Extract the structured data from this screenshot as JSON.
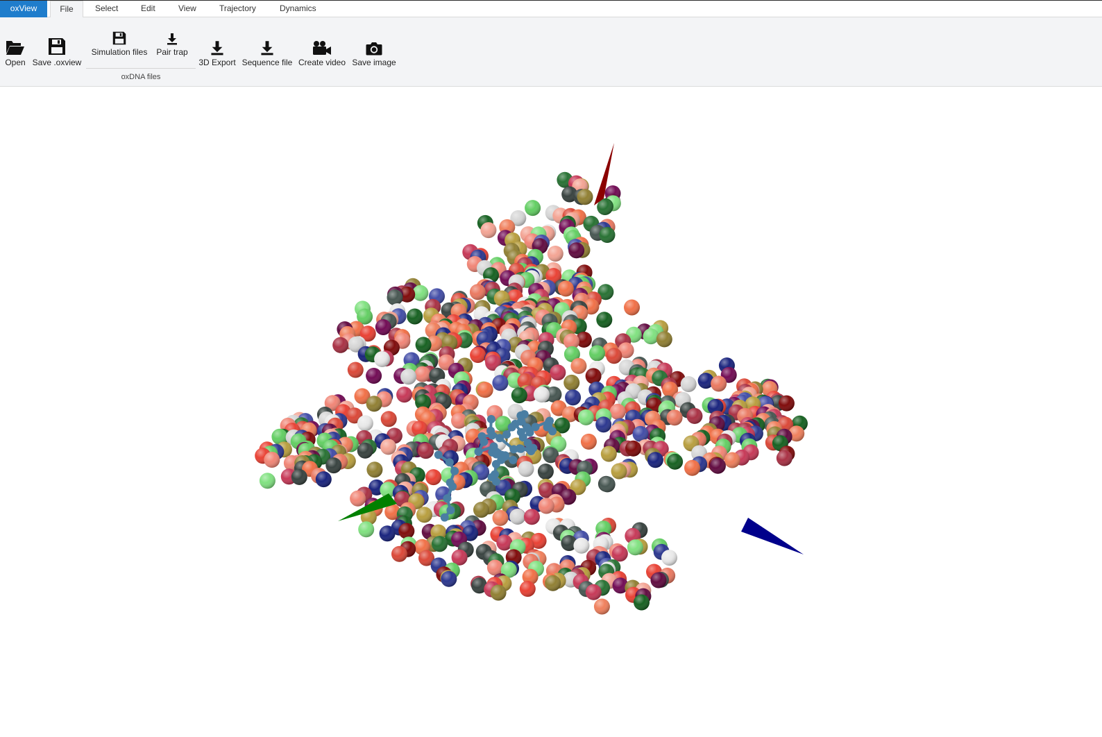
{
  "app": {
    "brand": "oxView"
  },
  "tabs": [
    {
      "label": "File",
      "active": true
    },
    {
      "label": "Select"
    },
    {
      "label": "Edit"
    },
    {
      "label": "View"
    },
    {
      "label": "Trajectory"
    },
    {
      "label": "Dynamics"
    }
  ],
  "ribbon": {
    "open": {
      "label": "Open",
      "icon": "folder-open-icon"
    },
    "save_oxview": {
      "label": "Save .oxview",
      "icon": "floppy-disk-icon"
    },
    "simulation_files": {
      "label": "Simulation files",
      "icon": "floppy-disk-icon"
    },
    "pair_trap": {
      "label": "Pair trap",
      "icon": "download-icon"
    },
    "group_label": "oxDNA files",
    "export_3d": {
      "label": "3D Export",
      "icon": "download-icon"
    },
    "sequence_file": {
      "label": "Sequence file",
      "icon": "download-icon"
    },
    "create_video": {
      "label": "Create video",
      "icon": "video-camera-icon"
    },
    "save_image": {
      "label": "Save image",
      "icon": "camera-icon"
    }
  },
  "scene": {
    "axis_colors": {
      "x": "#00008b",
      "y": "#8b0000",
      "z": "#008000"
    },
    "bead_palette": [
      "#e8392b",
      "#d9402f",
      "#f06a3f",
      "#ef7a55",
      "#e9735a",
      "#6b004d",
      "#5a0038",
      "#7a0000",
      "#222e8a",
      "#0f1a78",
      "#3a45a3",
      "#7be07b",
      "#5ccc5c",
      "#0c5a17",
      "#1e6b2a",
      "#3f4f4a",
      "#2f3a37",
      "#e8e8e8",
      "#d5d5d5",
      "#f08070",
      "#f3a08f",
      "#8c7a2a",
      "#b59a36",
      "#c43050",
      "#a5283c"
    ],
    "backbone_color": "#4a7ea3"
  }
}
